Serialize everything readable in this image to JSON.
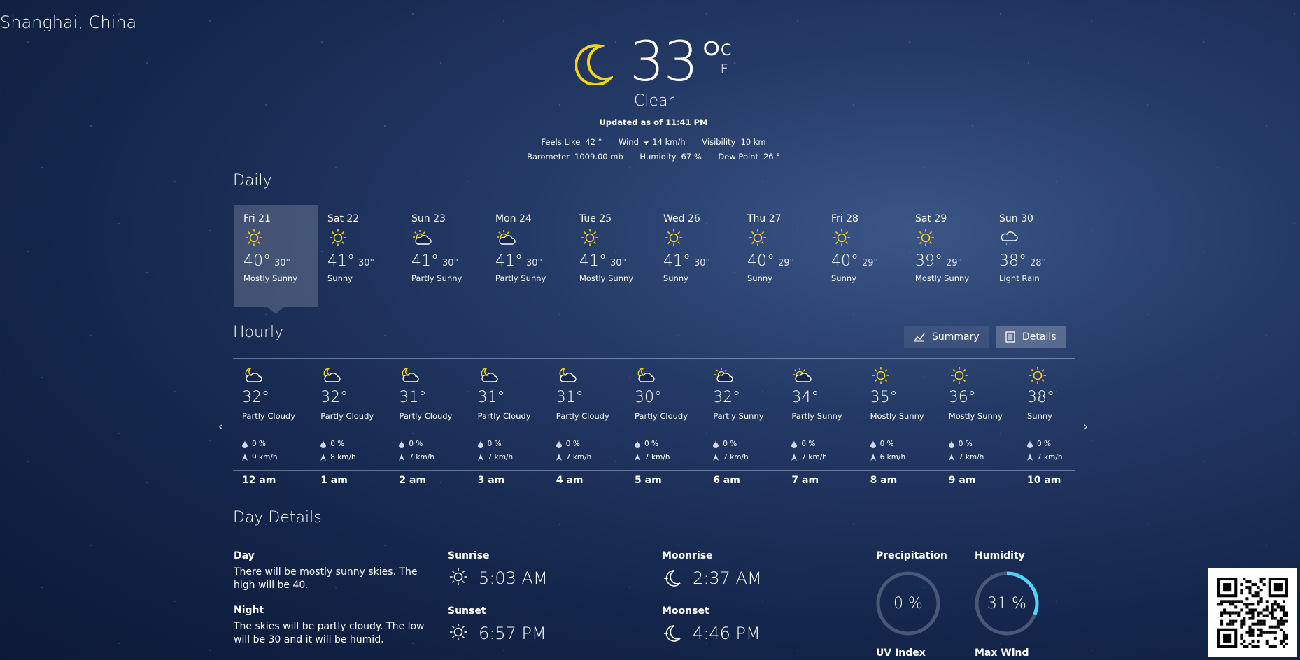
{
  "current": {
    "location": "Shanghai, China",
    "temperature": "33°",
    "unit_c": "C",
    "unit_f": "F",
    "condition": "Clear",
    "updated": "Updated as of 11:41 PM",
    "observations_row1": [
      {
        "label": "Feels Like",
        "value": "42 °"
      },
      {
        "label": "Wind",
        "value": "14 km/h"
      },
      {
        "label": "Visibility",
        "value": "10 km"
      }
    ],
    "observations_row2": [
      {
        "label": "Barometer",
        "value": "1009.00 mb"
      },
      {
        "label": "Humidity",
        "value": "67 %"
      },
      {
        "label": "Dew Point",
        "value": "26 °"
      }
    ]
  },
  "daily": {
    "title": "Daily",
    "days": [
      {
        "date": "Fri 21",
        "icon": "sun-icon",
        "high": "40°",
        "low": "30°",
        "desc": "Mostly Sunny",
        "selected": true
      },
      {
        "date": "Sat 22",
        "icon": "sun-icon",
        "high": "41°",
        "low": "30°",
        "desc": "Sunny"
      },
      {
        "date": "Sun 23",
        "icon": "partly-sunny-icon",
        "high": "41°",
        "low": "30°",
        "desc": "Partly Sunny"
      },
      {
        "date": "Mon 24",
        "icon": "partly-sunny-icon",
        "high": "41°",
        "low": "30°",
        "desc": "Partly Sunny"
      },
      {
        "date": "Tue 25",
        "icon": "sun-icon",
        "high": "41°",
        "low": "30°",
        "desc": "Mostly Sunny"
      },
      {
        "date": "Wed 26",
        "icon": "sun-icon",
        "high": "41°",
        "low": "30°",
        "desc": "Sunny"
      },
      {
        "date": "Thu 27",
        "icon": "sun-icon",
        "high": "40°",
        "low": "29°",
        "desc": "Sunny"
      },
      {
        "date": "Fri 28",
        "icon": "sun-icon",
        "high": "40°",
        "low": "29°",
        "desc": "Sunny"
      },
      {
        "date": "Sat 29",
        "icon": "sun-icon",
        "high": "39°",
        "low": "29°",
        "desc": "Mostly Sunny"
      },
      {
        "date": "Sun 30",
        "icon": "light-rain-icon",
        "high": "38°",
        "low": "28°",
        "desc": "Light Rain"
      }
    ]
  },
  "hourly": {
    "title": "Hourly",
    "summary_label": "Summary",
    "details_label": "Details",
    "hours": [
      {
        "time": "12 am",
        "icon": "partly-cloudy-night-icon",
        "temp": "32°",
        "desc": "Partly Cloudy",
        "precip": "0 %",
        "wind": "9 km/h"
      },
      {
        "time": "1 am",
        "icon": "partly-cloudy-night-icon",
        "temp": "32°",
        "desc": "Partly Cloudy",
        "precip": "0 %",
        "wind": "8 km/h"
      },
      {
        "time": "2 am",
        "icon": "partly-cloudy-night-icon",
        "temp": "31°",
        "desc": "Partly Cloudy",
        "precip": "0 %",
        "wind": "7 km/h"
      },
      {
        "time": "3 am",
        "icon": "partly-cloudy-night-icon",
        "temp": "31°",
        "desc": "Partly Cloudy",
        "precip": "0 %",
        "wind": "7 km/h"
      },
      {
        "time": "4 am",
        "icon": "partly-cloudy-night-icon",
        "temp": "31°",
        "desc": "Partly Cloudy",
        "precip": "0 %",
        "wind": "7 km/h"
      },
      {
        "time": "5 am",
        "icon": "partly-cloudy-night-icon",
        "temp": "30°",
        "desc": "Partly Cloudy",
        "precip": "0 %",
        "wind": "7 km/h"
      },
      {
        "time": "6 am",
        "icon": "partly-sunny-icon",
        "temp": "32°",
        "desc": "Partly Sunny",
        "precip": "0 %",
        "wind": "7 km/h"
      },
      {
        "time": "7 am",
        "icon": "partly-sunny-icon",
        "temp": "34°",
        "desc": "Partly Sunny",
        "precip": "0 %",
        "wind": "7 km/h"
      },
      {
        "time": "8 am",
        "icon": "sun-icon",
        "temp": "35°",
        "desc": "Mostly Sunny",
        "precip": "0 %",
        "wind": "6 km/h"
      },
      {
        "time": "9 am",
        "icon": "sun-icon",
        "temp": "36°",
        "desc": "Mostly Sunny",
        "precip": "0 %",
        "wind": "7 km/h"
      },
      {
        "time": "10 am",
        "icon": "sun-icon",
        "temp": "38°",
        "desc": "Sunny",
        "precip": "0 %",
        "wind": "7 km/h"
      }
    ]
  },
  "day_details": {
    "title": "Day Details",
    "day_label": "Day",
    "day_text": "There will be mostly sunny skies. The high will be 40.",
    "night_label": "Night",
    "night_text": "The skies will be partly cloudy. The low will be 30 and it will be humid.",
    "sunrise_label": "Sunrise",
    "sunrise": "5:03 AM",
    "sunset_label": "Sunset",
    "sunset": "6:57 PM",
    "moonrise_label": "Moonrise",
    "moonrise": "2:37 AM",
    "moonset_label": "Moonset",
    "moonset": "4:46 PM",
    "precip_label": "Precipitation",
    "precip": "0 %",
    "precip_fraction": 0.0,
    "humidity_label": "Humidity",
    "humidity": "31 %",
    "humidity_fraction": 0.31,
    "uv_label": "UV Index",
    "maxwind_label": "Max Wind"
  },
  "colors": {
    "sun": "#f5d215",
    "moon": "#f5d215",
    "gauge_track": "#4a5878",
    "gauge_fill": "#4fd3ff"
  }
}
